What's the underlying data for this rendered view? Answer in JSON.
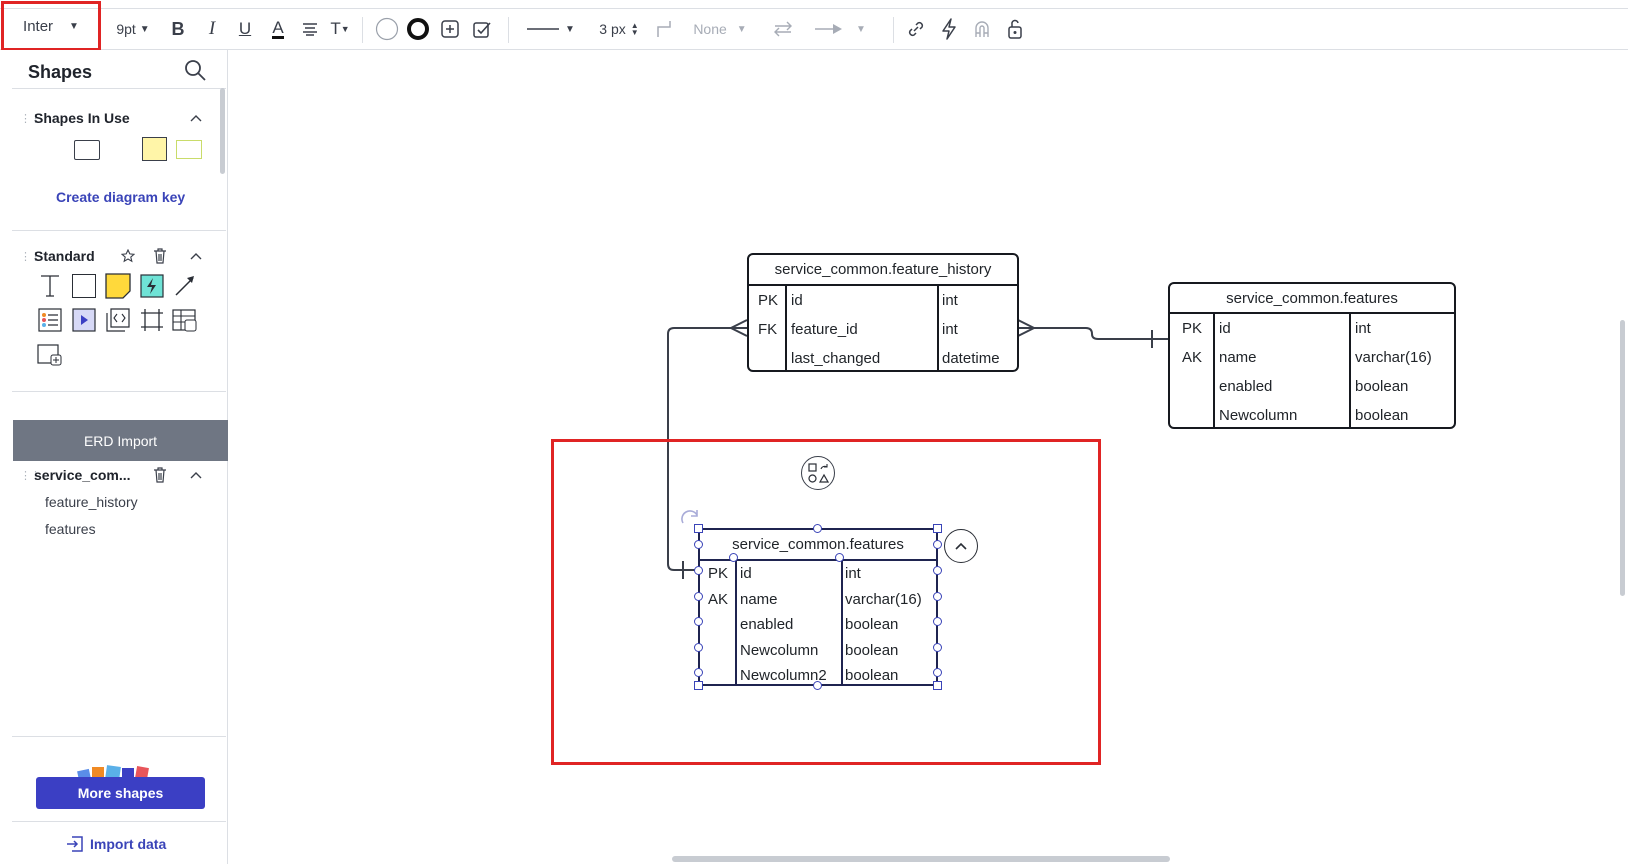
{
  "toolbar": {
    "font_family": "Inter",
    "font_size": "9pt",
    "bold": "B",
    "italic": "I",
    "underline": "U",
    "text_color": "A",
    "text_format": "T",
    "line_width": "3 px",
    "line_jump": "None"
  },
  "sidebar": {
    "title": "Shapes",
    "shapes_in_use_label": "Shapes In Use",
    "create_key_label": "Create diagram key",
    "standard_label": "Standard",
    "erd_import_label": "ERD Import",
    "erd_section_label": "service_com...",
    "erd_items": [
      "feature_history",
      "features"
    ],
    "more_shapes_label": "More shapes",
    "import_data_label": "Import data"
  },
  "entities": {
    "feature_history": {
      "title": "service_common.feature_history",
      "rows": [
        {
          "key": "PK",
          "name": "id",
          "type": "int"
        },
        {
          "key": "FK",
          "name": "feature_id",
          "type": "int"
        },
        {
          "key": "",
          "name": "last_changed",
          "type": "datetime"
        }
      ]
    },
    "features_right": {
      "title": "service_common.features",
      "rows": [
        {
          "key": "PK",
          "name": "id",
          "type": "int"
        },
        {
          "key": "AK",
          "name": "name",
          "type": "varchar(16)"
        },
        {
          "key": "",
          "name": "enabled",
          "type": "boolean"
        },
        {
          "key": "",
          "name": "Newcolumn",
          "type": "boolean"
        }
      ]
    },
    "features_selected": {
      "title": "service_common.features",
      "rows": [
        {
          "key": "PK",
          "name": "id",
          "type": "int"
        },
        {
          "key": "AK",
          "name": "name",
          "type": "varchar(16)"
        },
        {
          "key": "",
          "name": "enabled",
          "type": "boolean"
        },
        {
          "key": "",
          "name": "Newcolumn",
          "type": "boolean"
        },
        {
          "key": "",
          "name": "Newcolumn2",
          "type": "boolean"
        }
      ]
    }
  },
  "colors": {
    "accent": "#3b3fc4",
    "highlight": "#e02424",
    "shape_yellow": "#fff5a8",
    "shape_green_outline": "#c9dc6a"
  }
}
